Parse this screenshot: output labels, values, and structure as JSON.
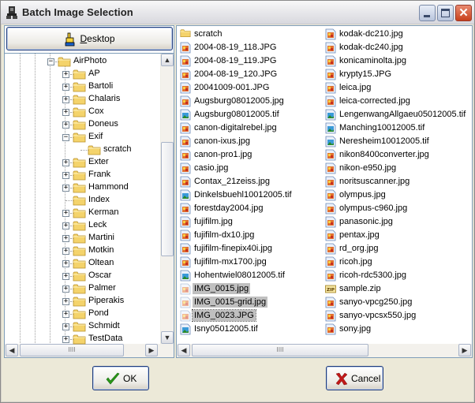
{
  "window": {
    "title": "Batch Image Selection",
    "controls": {
      "minimize": "minimize",
      "maximize": "maximize",
      "close": "close"
    }
  },
  "left_panel": {
    "desktop_button": {
      "label_underlined": "D",
      "label_rest": "esktop",
      "icon": "hand-pointer-icon"
    },
    "tree": {
      "items": [
        {
          "label": "AirPhoto",
          "level": 0,
          "expander": "minus"
        },
        {
          "label": "AP",
          "level": 1,
          "expander": "plus"
        },
        {
          "label": "Bartoli",
          "level": 1,
          "expander": "plus"
        },
        {
          "label": "Chalaris",
          "level": 1,
          "expander": "plus"
        },
        {
          "label": "Cox",
          "level": 1,
          "expander": "plus"
        },
        {
          "label": "Doneus",
          "level": 1,
          "expander": "plus"
        },
        {
          "label": "Exif",
          "level": 1,
          "expander": "minus"
        },
        {
          "label": "scratch",
          "level": 2,
          "expander": "none"
        },
        {
          "label": "Exter",
          "level": 1,
          "expander": "plus"
        },
        {
          "label": "Frank",
          "level": 1,
          "expander": "plus"
        },
        {
          "label": "Hammond",
          "level": 1,
          "expander": "plus"
        },
        {
          "label": "Index",
          "level": 1,
          "expander": "none"
        },
        {
          "label": "Kerman",
          "level": 1,
          "expander": "plus"
        },
        {
          "label": "Leck",
          "level": 1,
          "expander": "plus"
        },
        {
          "label": "Martini",
          "level": 1,
          "expander": "plus"
        },
        {
          "label": "Motkin",
          "level": 1,
          "expander": "plus"
        },
        {
          "label": "Oltean",
          "level": 1,
          "expander": "plus"
        },
        {
          "label": "Oscar",
          "level": 1,
          "expander": "plus"
        },
        {
          "label": "Palmer",
          "level": 1,
          "expander": "plus"
        },
        {
          "label": "Piperakis",
          "level": 1,
          "expander": "plus"
        },
        {
          "label": "Pond",
          "level": 1,
          "expander": "plus"
        },
        {
          "label": "Schmidt",
          "level": 1,
          "expander": "plus"
        },
        {
          "label": "TestData",
          "level": 1,
          "expander": "plus"
        }
      ]
    }
  },
  "file_list": {
    "columns": [
      [
        {
          "name": "scratch",
          "type": "folder"
        },
        {
          "name": "2004-08-19_118.JPG",
          "type": "jpg"
        },
        {
          "name": "2004-08-19_119.JPG",
          "type": "jpg"
        },
        {
          "name": "2004-08-19_120.JPG",
          "type": "jpg"
        },
        {
          "name": "20041009-001.JPG",
          "type": "jpg"
        },
        {
          "name": "Augsburg08012005.jpg",
          "type": "jpg"
        },
        {
          "name": "Augsburg08012005.tif",
          "type": "tif"
        },
        {
          "name": "canon-digitalrebel.jpg",
          "type": "jpg"
        },
        {
          "name": "canon-ixus.jpg",
          "type": "jpg"
        },
        {
          "name": "canon-pro1.jpg",
          "type": "jpg"
        },
        {
          "name": "casio.jpg",
          "type": "jpg"
        },
        {
          "name": "Contax_21zeiss.jpg",
          "type": "jpg"
        },
        {
          "name": "Dinkelsbuehl10012005.tif",
          "type": "tif"
        },
        {
          "name": "forestday2004.jpg",
          "type": "jpg"
        },
        {
          "name": "fujifilm.jpg",
          "type": "jpg"
        },
        {
          "name": "fujifilm-dx10.jpg",
          "type": "jpg"
        },
        {
          "name": "fujifilm-finepix40i.jpg",
          "type": "jpg"
        },
        {
          "name": "fujifilm-mx1700.jpg",
          "type": "jpg"
        },
        {
          "name": "Hohentwiel08012005.tif",
          "type": "tif"
        },
        {
          "name": "IMG_0015.jpg",
          "type": "jpg",
          "selected": true
        },
        {
          "name": "IMG_0015-grid.jpg",
          "type": "jpg",
          "selected": true
        },
        {
          "name": "IMG_0023.JPG",
          "type": "jpg",
          "selected": true,
          "focused": true
        },
        {
          "name": "Isny05012005.tif",
          "type": "tif"
        }
      ],
      [
        {
          "name": "kodak-dc210.jpg",
          "type": "jpg"
        },
        {
          "name": "kodak-dc240.jpg",
          "type": "jpg"
        },
        {
          "name": "konicaminolta.jpg",
          "type": "jpg"
        },
        {
          "name": "krypty15.JPG",
          "type": "jpg"
        },
        {
          "name": "leica.jpg",
          "type": "jpg"
        },
        {
          "name": "leica-corrected.jpg",
          "type": "jpg"
        },
        {
          "name": "LengenwangAllgaeu05012005.tif",
          "type": "tif"
        },
        {
          "name": "Manching10012005.tif",
          "type": "tif"
        },
        {
          "name": "Neresheim10012005.tif",
          "type": "tif"
        },
        {
          "name": "nikon8400converter.jpg",
          "type": "jpg"
        },
        {
          "name": "nikon-e950.jpg",
          "type": "jpg"
        },
        {
          "name": "noritsuscanner.jpg",
          "type": "jpg"
        },
        {
          "name": "olympus.jpg",
          "type": "jpg"
        },
        {
          "name": "olympus-c960.jpg",
          "type": "jpg"
        },
        {
          "name": "panasonic.jpg",
          "type": "jpg"
        },
        {
          "name": "pentax.jpg",
          "type": "jpg"
        },
        {
          "name": "rd_org.jpg",
          "type": "jpg"
        },
        {
          "name": "ricoh.jpg",
          "type": "jpg"
        },
        {
          "name": "ricoh-rdc5300.jpg",
          "type": "jpg"
        },
        {
          "name": "sample.zip",
          "type": "zip"
        },
        {
          "name": "sanyo-vpcg250.jpg",
          "type": "jpg"
        },
        {
          "name": "sanyo-vpcsx550.jpg",
          "type": "jpg"
        },
        {
          "name": "sony.jpg",
          "type": "jpg"
        }
      ]
    ]
  },
  "buttons": {
    "ok": {
      "label": "OK",
      "icon": "checkmark-icon"
    },
    "cancel": {
      "label": "Cancel",
      "icon": "x-mark-icon"
    }
  },
  "scroll": {
    "tree_vertical_position": 0.45,
    "tree_horizontal_position": 0.0,
    "files_horizontal_position": 0.0
  },
  "colors": {
    "selection": "#c0c0c0",
    "border": "#7f9db9",
    "folder": "#f4d36b",
    "ok_check": "#2a9a18",
    "cancel_x": "#c01818"
  }
}
